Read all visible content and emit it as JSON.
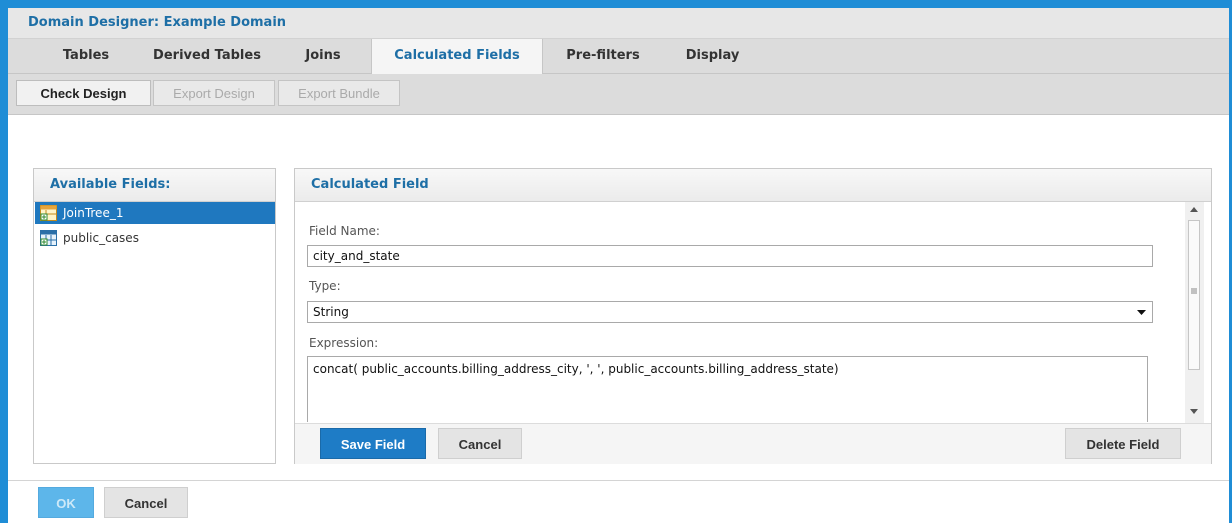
{
  "window": {
    "title": "Domain Designer: Example Domain"
  },
  "tabs": [
    {
      "label": "Tables",
      "active": false
    },
    {
      "label": "Derived Tables",
      "active": false
    },
    {
      "label": "Joins",
      "active": false
    },
    {
      "label": "Calculated Fields",
      "active": true
    },
    {
      "label": "Pre-filters",
      "active": false
    },
    {
      "label": "Display",
      "active": false
    }
  ],
  "toolbar": {
    "check_design": "Check Design",
    "export_design": "Export Design",
    "export_bundle": "Export Bundle"
  },
  "available_fields": {
    "title": "Available Fields:",
    "items": [
      {
        "label": "JoinTree_1",
        "icon": "join-tree-icon",
        "selected": true
      },
      {
        "label": "public_cases",
        "icon": "table-icon",
        "selected": false
      }
    ]
  },
  "calculated_field": {
    "title": "Calculated Field",
    "field_name_label": "Field Name:",
    "field_name_value": "city_and_state",
    "type_label": "Type:",
    "type_value": "String",
    "expression_label": "Expression:",
    "expression_value": "concat( public_accounts.billing_address_city, ', ', public_accounts.billing_address_state)",
    "save_button": "Save Field",
    "cancel_button": "Cancel",
    "delete_button": "Delete Field"
  },
  "footer": {
    "ok_button": "OK",
    "cancel_button": "Cancel"
  },
  "colors": {
    "frame": "#1f8dd6",
    "accent": "#1e7cc6",
    "title_text": "#1e6fa6"
  }
}
